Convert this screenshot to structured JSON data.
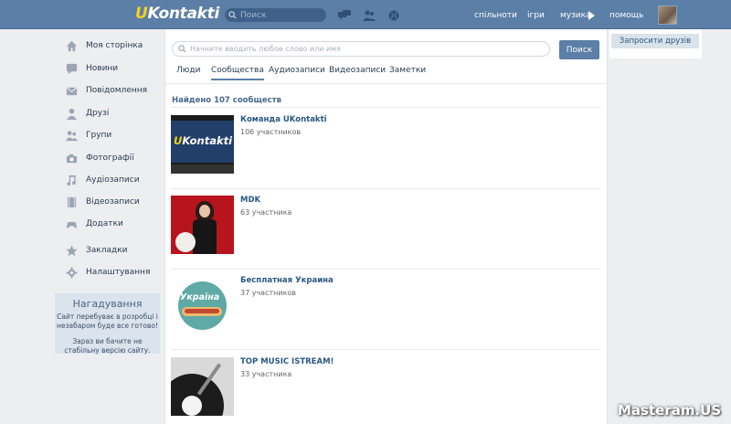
{
  "header": {
    "logo_u": "U",
    "logo_rest": "Kontakti",
    "search_placeholder": "Поиск",
    "nav": [
      "спільноти",
      "ігри",
      "музика",
      "помощь"
    ],
    "icons": [
      "chat-bubbles-icon",
      "friends-icon",
      "globe-icon"
    ]
  },
  "sidebar": {
    "items": [
      {
        "label": "Моя сторінка",
        "icon": "home-icon"
      },
      {
        "label": "Новини",
        "icon": "news-icon"
      },
      {
        "label": "Повідомлення",
        "icon": "envelope-icon"
      },
      {
        "label": "Друзі",
        "icon": "user-icon"
      },
      {
        "label": "Групи",
        "icon": "group-icon"
      },
      {
        "label": "Фотографії",
        "icon": "camera-icon"
      },
      {
        "label": "Аудіозаписи",
        "icon": "music-note-icon"
      },
      {
        "label": "Відеозаписи",
        "icon": "film-icon"
      },
      {
        "label": "Додатки",
        "icon": "gamepad-icon"
      },
      {
        "label": "Закладки",
        "icon": "star-icon"
      },
      {
        "label": "Налаштування",
        "icon": "gear-icon"
      }
    ],
    "notice": {
      "title": "Нагадування",
      "line1": "Сайт перебуває в розробці і незабаром буде все готово!",
      "line2": "Зараз ви бачите не стабільну версію сайту."
    }
  },
  "main": {
    "search_placeholder": "Начните вводить любое слово или имя",
    "search_button": "Поиск",
    "tabs": [
      "Люди",
      "Сообщества",
      "Аудиозаписи",
      "Видеозаписи",
      "Заметки"
    ],
    "active_tab": "Сообщества",
    "found": "Найдено 107 сообществ",
    "groups": [
      {
        "name": "Команда UKontakti",
        "count": "106 участников",
        "thumb_text_u": "U",
        "thumb_text_rest": "Kontakti"
      },
      {
        "name": "MDK",
        "count": "63 участника"
      },
      {
        "name": "Бесплатная Украина",
        "count": "37 участников",
        "thumb_text": "Україна"
      },
      {
        "name": "TOP MUSIC ISTREAM!",
        "count": "33 участника"
      }
    ]
  },
  "right": {
    "invite_button": "Запросити друзів"
  },
  "watermark": "Masteram.US",
  "colors": {
    "header_bg": "#5b7fa6",
    "link": "#2a5885",
    "page_bg": "#edeef0",
    "logo_accent": "#f5d020"
  }
}
